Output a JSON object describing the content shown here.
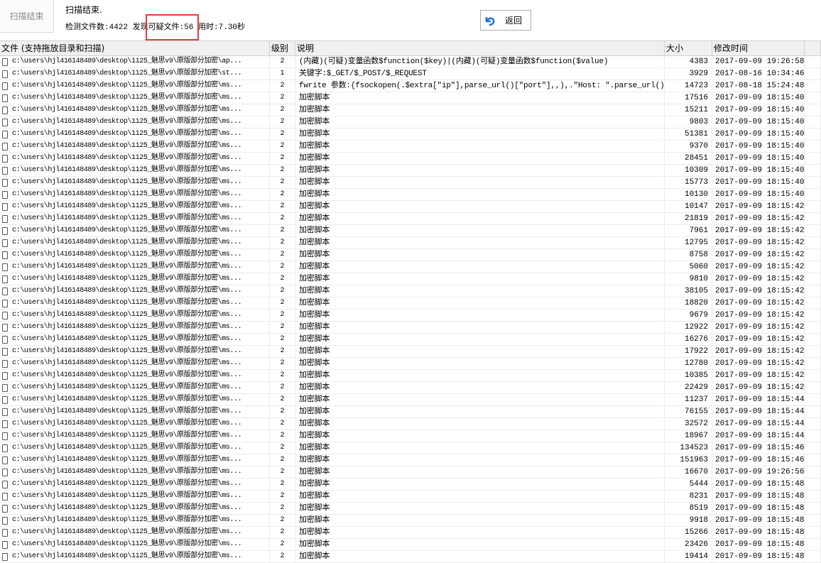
{
  "toolbar": {
    "scan_button": "扫描结束",
    "back_button": "返回",
    "back_icon": "undo-arrow-icon"
  },
  "status": {
    "title": "扫描结束.",
    "stats": "检测文件数:4422 发现可疑文件:56 用时:7.30秒"
  },
  "colors": {
    "highlight": "#e83a3a",
    "back_icon": "#1a6fd6"
  },
  "columns": [
    "文件 (支持拖放目录和扫描)",
    "级别",
    "说明",
    "大小",
    "修改时间"
  ],
  "rows": [
    {
      "file": "c:\\users\\hjl416148489\\desktop\\1125_魅思v9\\原版部分加密\\ap...",
      "level": "2",
      "desc": "(内藏)(可疑)变量函数$function($key)|(内藏)(可疑)变量函数$function($value)",
      "size": "4383",
      "time": "2017-09-09 19:26:58"
    },
    {
      "file": "c:\\users\\hjl416148489\\desktop\\1125_魅思v9\\原版部分加密\\st...",
      "level": "1",
      "desc": "关键字:$_GET/$_POST/$_REQUEST",
      "size": "3929",
      "time": "2017-08-16 10:34:46"
    },
    {
      "file": "c:\\users\\hjl416148489\\desktop\\1125_魅思v9\\原版部分加密\\ms...",
      "level": "2",
      "desc": "fwrite 参数:{fsockopen(.$extra[\"ip\"],parse_url()[\"port\"],,),.\"Host: \".parse_url()...",
      "size": "14723",
      "time": "2017-08-18 15:24:48"
    },
    {
      "file": "c:\\users\\hjl416148489\\desktop\\1125_魅思v9\\原版部分加密\\ms...",
      "level": "2",
      "desc": "加密脚本",
      "size": "17516",
      "time": "2017-09-09 18:15:40"
    },
    {
      "file": "c:\\users\\hjl416148489\\desktop\\1125_魅思v9\\原版部分加密\\ms...",
      "level": "2",
      "desc": "加密脚本",
      "size": "15211",
      "time": "2017-09-09 18:15:40"
    },
    {
      "file": "c:\\users\\hjl416148489\\desktop\\1125_魅思v9\\原版部分加密\\ms...",
      "level": "2",
      "desc": "加密脚本",
      "size": "9803",
      "time": "2017-09-09 18:15:40"
    },
    {
      "file": "c:\\users\\hjl416148489\\desktop\\1125_魅思v9\\原版部分加密\\ms...",
      "level": "2",
      "desc": "加密脚本",
      "size": "51381",
      "time": "2017-09-09 18:15:40"
    },
    {
      "file": "c:\\users\\hjl416148489\\desktop\\1125_魅思v9\\原版部分加密\\ms...",
      "level": "2",
      "desc": "加密脚本",
      "size": "9370",
      "time": "2017-09-09 18:15:40"
    },
    {
      "file": "c:\\users\\hjl416148489\\desktop\\1125_魅思v9\\原版部分加密\\ms...",
      "level": "2",
      "desc": "加密脚本",
      "size": "28451",
      "time": "2017-09-09 18:15:40"
    },
    {
      "file": "c:\\users\\hjl416148489\\desktop\\1125_魅思v9\\原版部分加密\\ms...",
      "level": "2",
      "desc": "加密脚本",
      "size": "10309",
      "time": "2017-09-09 18:15:40"
    },
    {
      "file": "c:\\users\\hjl416148489\\desktop\\1125_魅思v9\\原版部分加密\\ms...",
      "level": "2",
      "desc": "加密脚本",
      "size": "15773",
      "time": "2017-09-09 18:15:40"
    },
    {
      "file": "c:\\users\\hjl416148489\\desktop\\1125_魅思v9\\原版部分加密\\ms...",
      "level": "2",
      "desc": "加密脚本",
      "size": "10130",
      "time": "2017-09-09 18:15:40"
    },
    {
      "file": "c:\\users\\hjl416148489\\desktop\\1125_魅思v9\\原版部分加密\\ms...",
      "level": "2",
      "desc": "加密脚本",
      "size": "10147",
      "time": "2017-09-09 18:15:42"
    },
    {
      "file": "c:\\users\\hjl416148489\\desktop\\1125_魅思v9\\原版部分加密\\ms...",
      "level": "2",
      "desc": "加密脚本",
      "size": "21819",
      "time": "2017-09-09 18:15:42"
    },
    {
      "file": "c:\\users\\hjl416148489\\desktop\\1125_魅思v9\\原版部分加密\\ms...",
      "level": "2",
      "desc": "加密脚本",
      "size": "7961",
      "time": "2017-09-09 18:15:42"
    },
    {
      "file": "c:\\users\\hjl416148489\\desktop\\1125_魅思v9\\原版部分加密\\ms...",
      "level": "2",
      "desc": "加密脚本",
      "size": "12795",
      "time": "2017-09-09 18:15:42"
    },
    {
      "file": "c:\\users\\hjl416148489\\desktop\\1125_魅思v9\\原版部分加密\\ms...",
      "level": "2",
      "desc": "加密脚本",
      "size": "8758",
      "time": "2017-09-09 18:15:42"
    },
    {
      "file": "c:\\users\\hjl416148489\\desktop\\1125_魅思v9\\原版部分加密\\ms...",
      "level": "2",
      "desc": "加密脚本",
      "size": "5060",
      "time": "2017-09-09 18:15:42"
    },
    {
      "file": "c:\\users\\hjl416148489\\desktop\\1125_魅思v9\\原版部分加密\\ms...",
      "level": "2",
      "desc": "加密脚本",
      "size": "9810",
      "time": "2017-09-09 18:15:42"
    },
    {
      "file": "c:\\users\\hjl416148489\\desktop\\1125_魅思v9\\原版部分加密\\ms...",
      "level": "2",
      "desc": "加密脚本",
      "size": "38105",
      "time": "2017-09-09 18:15:42"
    },
    {
      "file": "c:\\users\\hjl416148489\\desktop\\1125_魅思v9\\原版部分加密\\ms...",
      "level": "2",
      "desc": "加密脚本",
      "size": "18820",
      "time": "2017-09-09 18:15:42"
    },
    {
      "file": "c:\\users\\hjl416148489\\desktop\\1125_魅思v9\\原版部分加密\\ms...",
      "level": "2",
      "desc": "加密脚本",
      "size": "9679",
      "time": "2017-09-09 18:15:42"
    },
    {
      "file": "c:\\users\\hjl416148489\\desktop\\1125_魅思v9\\原版部分加密\\ms...",
      "level": "2",
      "desc": "加密脚本",
      "size": "12922",
      "time": "2017-09-09 18:15:42"
    },
    {
      "file": "c:\\users\\hjl416148489\\desktop\\1125_魅思v9\\原版部分加密\\ms...",
      "level": "2",
      "desc": "加密脚本",
      "size": "16276",
      "time": "2017-09-09 18:15:42"
    },
    {
      "file": "c:\\users\\hjl416148489\\desktop\\1125_魅思v9\\原版部分加密\\ms...",
      "level": "2",
      "desc": "加密脚本",
      "size": "17922",
      "time": "2017-09-09 18:15:42"
    },
    {
      "file": "c:\\users\\hjl416148489\\desktop\\1125_魅思v9\\原版部分加密\\ms...",
      "level": "2",
      "desc": "加密脚本",
      "size": "12780",
      "time": "2017-09-09 18:15:42"
    },
    {
      "file": "c:\\users\\hjl416148489\\desktop\\1125_魅思v9\\原版部分加密\\ms...",
      "level": "2",
      "desc": "加密脚本",
      "size": "10385",
      "time": "2017-09-09 18:15:42"
    },
    {
      "file": "c:\\users\\hjl416148489\\desktop\\1125_魅思v9\\原版部分加密\\ms...",
      "level": "2",
      "desc": "加密脚本",
      "size": "22429",
      "time": "2017-09-09 18:15:42"
    },
    {
      "file": "c:\\users\\hjl416148489\\desktop\\1125_魅思v9\\原版部分加密\\ms...",
      "level": "2",
      "desc": "加密脚本",
      "size": "11237",
      "time": "2017-09-09 18:15:44"
    },
    {
      "file": "c:\\users\\hjl416148489\\desktop\\1125_魅思v9\\原版部分加密\\ms...",
      "level": "2",
      "desc": "加密脚本",
      "size": "76155",
      "time": "2017-09-09 18:15:44"
    },
    {
      "file": "c:\\users\\hjl416148489\\desktop\\1125_魅思v9\\原版部分加密\\ms...",
      "level": "2",
      "desc": "加密脚本",
      "size": "32572",
      "time": "2017-09-09 18:15:44"
    },
    {
      "file": "c:\\users\\hjl416148489\\desktop\\1125_魅思v9\\原版部分加密\\ms...",
      "level": "2",
      "desc": "加密脚本",
      "size": "18967",
      "time": "2017-09-09 18:15:44"
    },
    {
      "file": "c:\\users\\hjl416148489\\desktop\\1125_魅思v9\\原版部分加密\\ms...",
      "level": "2",
      "desc": "加密脚本",
      "size": "134523",
      "time": "2017-09-09 18:15:46"
    },
    {
      "file": "c:\\users\\hjl416148489\\desktop\\1125_魅思v9\\原版部分加密\\ms...",
      "level": "2",
      "desc": "加密脚本",
      "size": "151963",
      "time": "2017-09-09 18:15:46"
    },
    {
      "file": "c:\\users\\hjl416148489\\desktop\\1125_魅思v9\\原版部分加密\\ms...",
      "level": "2",
      "desc": "加密脚本",
      "size": "16670",
      "time": "2017-09-09 19:26:56"
    },
    {
      "file": "c:\\users\\hjl416148489\\desktop\\1125_魅思v9\\原版部分加密\\ms...",
      "level": "2",
      "desc": "加密脚本",
      "size": "5444",
      "time": "2017-09-09 18:15:48"
    },
    {
      "file": "c:\\users\\hjl416148489\\desktop\\1125_魅思v9\\原版部分加密\\ms...",
      "level": "2",
      "desc": "加密脚本",
      "size": "8231",
      "time": "2017-09-09 18:15:48"
    },
    {
      "file": "c:\\users\\hjl416148489\\desktop\\1125_魅思v9\\原版部分加密\\ms...",
      "level": "2",
      "desc": "加密脚本",
      "size": "8519",
      "time": "2017-09-09 18:15:48"
    },
    {
      "file": "c:\\users\\hjl416148489\\desktop\\1125_魅思v9\\原版部分加密\\ms...",
      "level": "2",
      "desc": "加密脚本",
      "size": "9918",
      "time": "2017-09-09 18:15:48"
    },
    {
      "file": "c:\\users\\hjl416148489\\desktop\\1125_魅思v9\\原版部分加密\\ms...",
      "level": "2",
      "desc": "加密脚本",
      "size": "15266",
      "time": "2017-09-09 18:15:48"
    },
    {
      "file": "c:\\users\\hjl416148489\\desktop\\1125_魅思v9\\原版部分加密\\ms...",
      "level": "2",
      "desc": "加密脚本",
      "size": "23426",
      "time": "2017-09-09 18:15:48"
    },
    {
      "file": "c:\\users\\hjl416148489\\desktop\\1125_魅思v9\\原版部分加密\\ms...",
      "level": "2",
      "desc": "加密脚本",
      "size": "19414",
      "time": "2017-09-09 18:15:48"
    }
  ]
}
